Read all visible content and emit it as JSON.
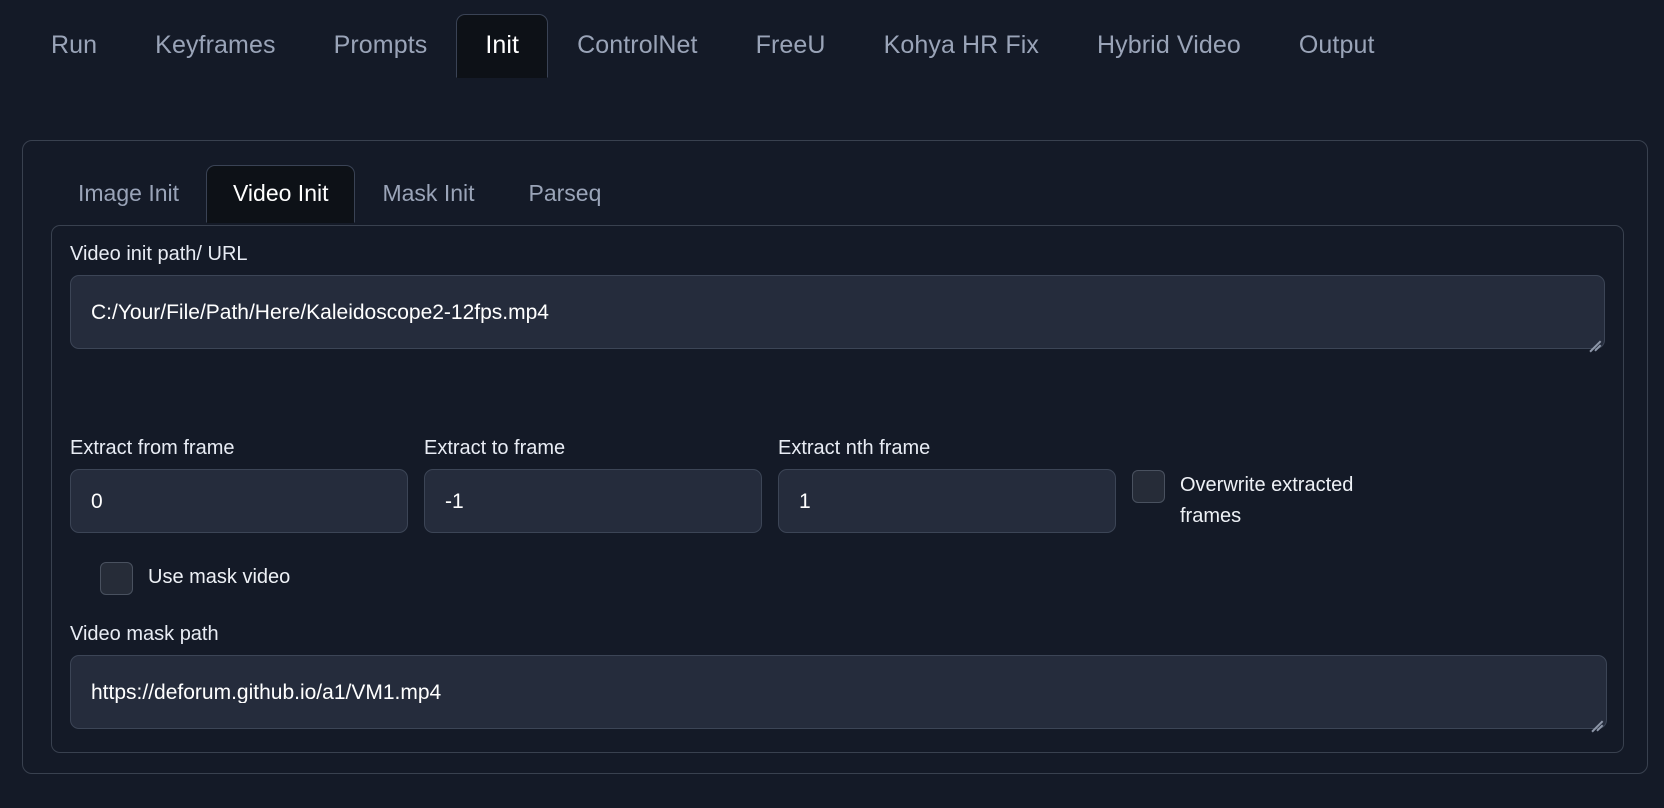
{
  "app": {
    "background": "#141a27",
    "panel_border": "#39414f",
    "input_bg": "#252c3c",
    "active_tab_bg": "#0d1117",
    "text_color": "#ffffff",
    "muted_text_color": "#9aa4b8"
  },
  "top_tabs": [
    {
      "label": "Run",
      "active": false
    },
    {
      "label": "Keyframes",
      "active": false
    },
    {
      "label": "Prompts",
      "active": false
    },
    {
      "label": "Init",
      "active": true
    },
    {
      "label": "ControlNet",
      "active": false
    },
    {
      "label": "FreeU",
      "active": false
    },
    {
      "label": "Kohya HR Fix",
      "active": false
    },
    {
      "label": "Hybrid Video",
      "active": false
    },
    {
      "label": "Output",
      "active": false
    }
  ],
  "sub_tabs": [
    {
      "label": "Image Init",
      "active": false
    },
    {
      "label": "Video Init",
      "active": true
    },
    {
      "label": "Mask Init",
      "active": false
    },
    {
      "label": "Parseq",
      "active": false
    }
  ],
  "video_init": {
    "path_label": "Video init path/ URL",
    "path_value": "C:/Your/File/Path/Here/Kaleidoscope2-12fps.mp4",
    "extract_from_label": "Extract from frame",
    "extract_from_value": "0",
    "extract_to_label": "Extract to frame",
    "extract_to_value": "-1",
    "extract_nth_label": "Extract nth frame",
    "extract_nth_value": "1",
    "overwrite_label": "Overwrite extracted frames",
    "overwrite_checked": false,
    "use_mask_video_label": "Use mask video",
    "use_mask_video_checked": false,
    "mask_path_label": "Video mask path",
    "mask_path_value": "https://deforum.github.io/a1/VM1.mp4"
  }
}
